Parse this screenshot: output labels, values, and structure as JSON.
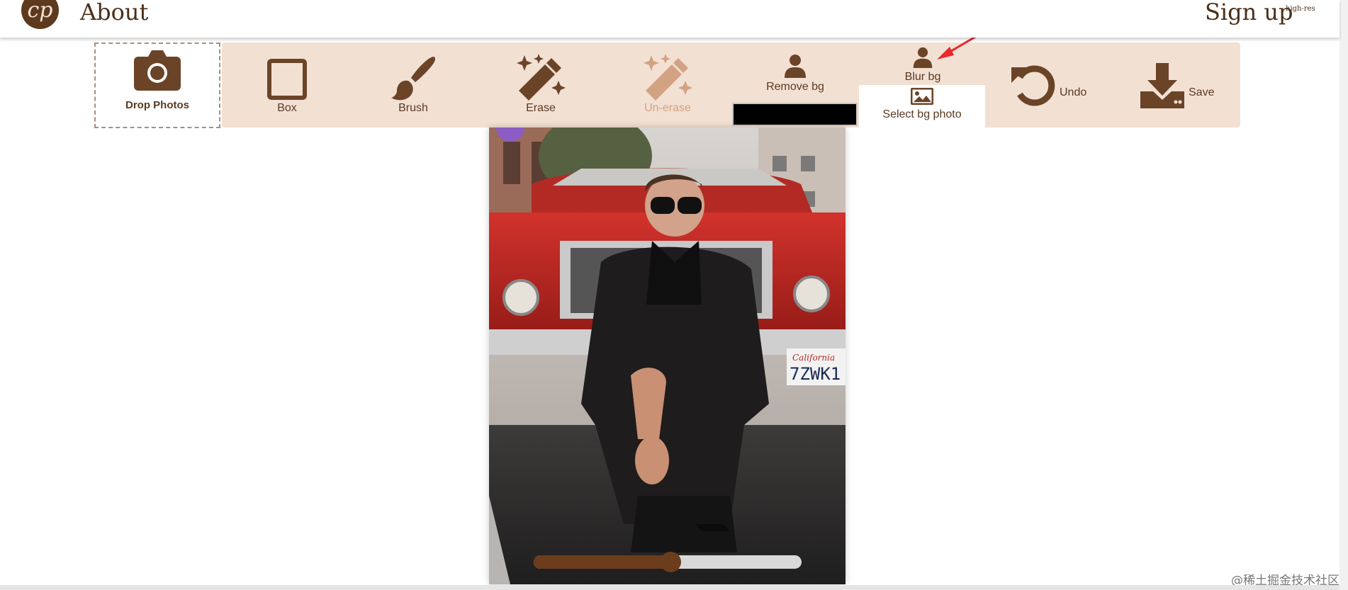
{
  "header": {
    "logo_text": "cp",
    "nav_about": "About",
    "nav_signup": "Sign up",
    "signup_superscript": "high-res"
  },
  "toolbar": {
    "drop_label": "Drop Photos",
    "tools": {
      "box": "Box",
      "brush": "Brush",
      "erase": "Erase",
      "unerase": "Un-erase",
      "remove_bg": "Remove bg",
      "blur_bg": "Blur bg",
      "select_bg_photo": "Select bg photo",
      "undo": "Undo",
      "save": "Save"
    }
  },
  "photo": {
    "license_plate_brand": "California",
    "license_plate_number": "7ZWK1"
  },
  "slider": {
    "value_fraction": 0.48
  },
  "watermark": "@稀土掘金技术社区",
  "colors": {
    "brand_brown": "#5a3a22",
    "toolbar_bg": "#f2e0d3",
    "disabled_tool": "#d3a283",
    "annotation_arrow": "#e8282d"
  }
}
